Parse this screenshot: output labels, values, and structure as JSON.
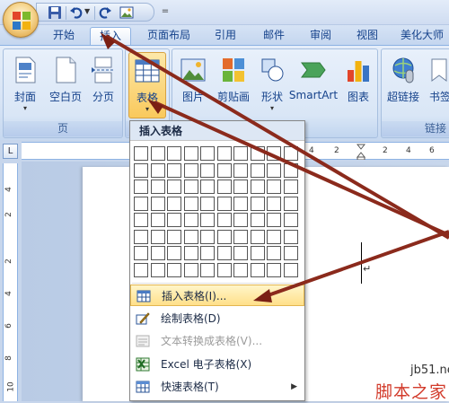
{
  "quick_access": {
    "icons": [
      "save-icon",
      "undo-icon",
      "redo-icon",
      "picture-icon"
    ],
    "more": "="
  },
  "tabs": [
    {
      "label": "开始",
      "active": false
    },
    {
      "label": "插入",
      "active": true
    },
    {
      "label": "页面布局",
      "active": false
    },
    {
      "label": "引用",
      "active": false
    },
    {
      "label": "邮件",
      "active": false
    },
    {
      "label": "审阅",
      "active": false
    },
    {
      "label": "视图",
      "active": false
    },
    {
      "label": "美化大师",
      "active": false
    }
  ],
  "ribbon": {
    "groups": {
      "pages": {
        "label": "页",
        "buttons": [
          "封面",
          "空白页",
          "分页"
        ]
      },
      "tables": {
        "label": "",
        "buttons": [
          "表格"
        ]
      },
      "illustrations": {
        "buttons": [
          "图片",
          "剪贴画",
          "形状",
          "SmartArt",
          "图表"
        ]
      },
      "links": {
        "label": "链接",
        "buttons": [
          "超链接",
          "书签"
        ]
      }
    }
  },
  "ruler": {
    "corner": "L",
    "h_numbers": [
      "4",
      "2",
      "2",
      "4",
      "6"
    ],
    "v_numbers": [
      "4",
      "2",
      "2",
      "4",
      "6",
      "8",
      "10"
    ]
  },
  "document": {
    "paragraph_mark": "↵"
  },
  "menu": {
    "header": "插入表格",
    "grid": {
      "cols": 10,
      "rows": 8
    },
    "items": [
      {
        "label": "插入表格(I)...",
        "icon": "insert-table-icon",
        "state": "hover"
      },
      {
        "label": "绘制表格(D)",
        "icon": "draw-table-icon",
        "state": "normal"
      },
      {
        "label": "文本转换成表格(V)...",
        "icon": "text-to-table-icon",
        "state": "disabled"
      },
      {
        "label": "Excel 电子表格(X)",
        "icon": "excel-icon",
        "state": "normal"
      },
      {
        "label": "快速表格(T)",
        "icon": "quick-table-icon",
        "state": "normal",
        "submenu": "▶"
      }
    ]
  },
  "watermark": {
    "url": "jb51.net",
    "name": "脚本之家"
  }
}
